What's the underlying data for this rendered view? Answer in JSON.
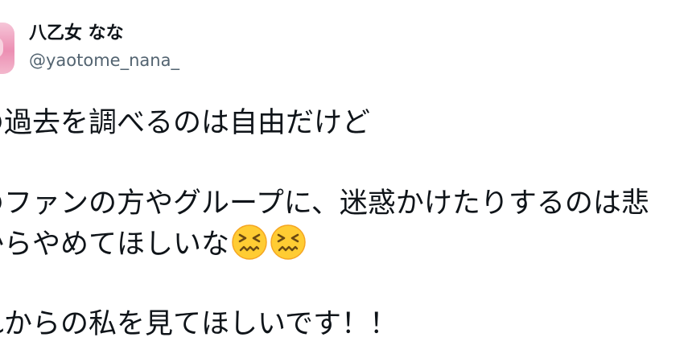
{
  "author": {
    "display_name": "八乙女 なな",
    "handle": "@yaotome_nana_"
  },
  "tweet": {
    "line1": "の過去を調べるのは自由だけど",
    "line2": "のファンの方やグループに、迷惑かけたりするのは悲",
    "line3": "からやめてほしいな",
    "line4": "れからの私を見てほしいです！！",
    "emojis": [
      "confounded-face-icon",
      "confounded-face-icon"
    ]
  },
  "colors": {
    "text": "#0f1419",
    "secondary_text": "#536471",
    "emoji_fill": "#ffcc33",
    "emoji_outline": "#f5a623"
  }
}
